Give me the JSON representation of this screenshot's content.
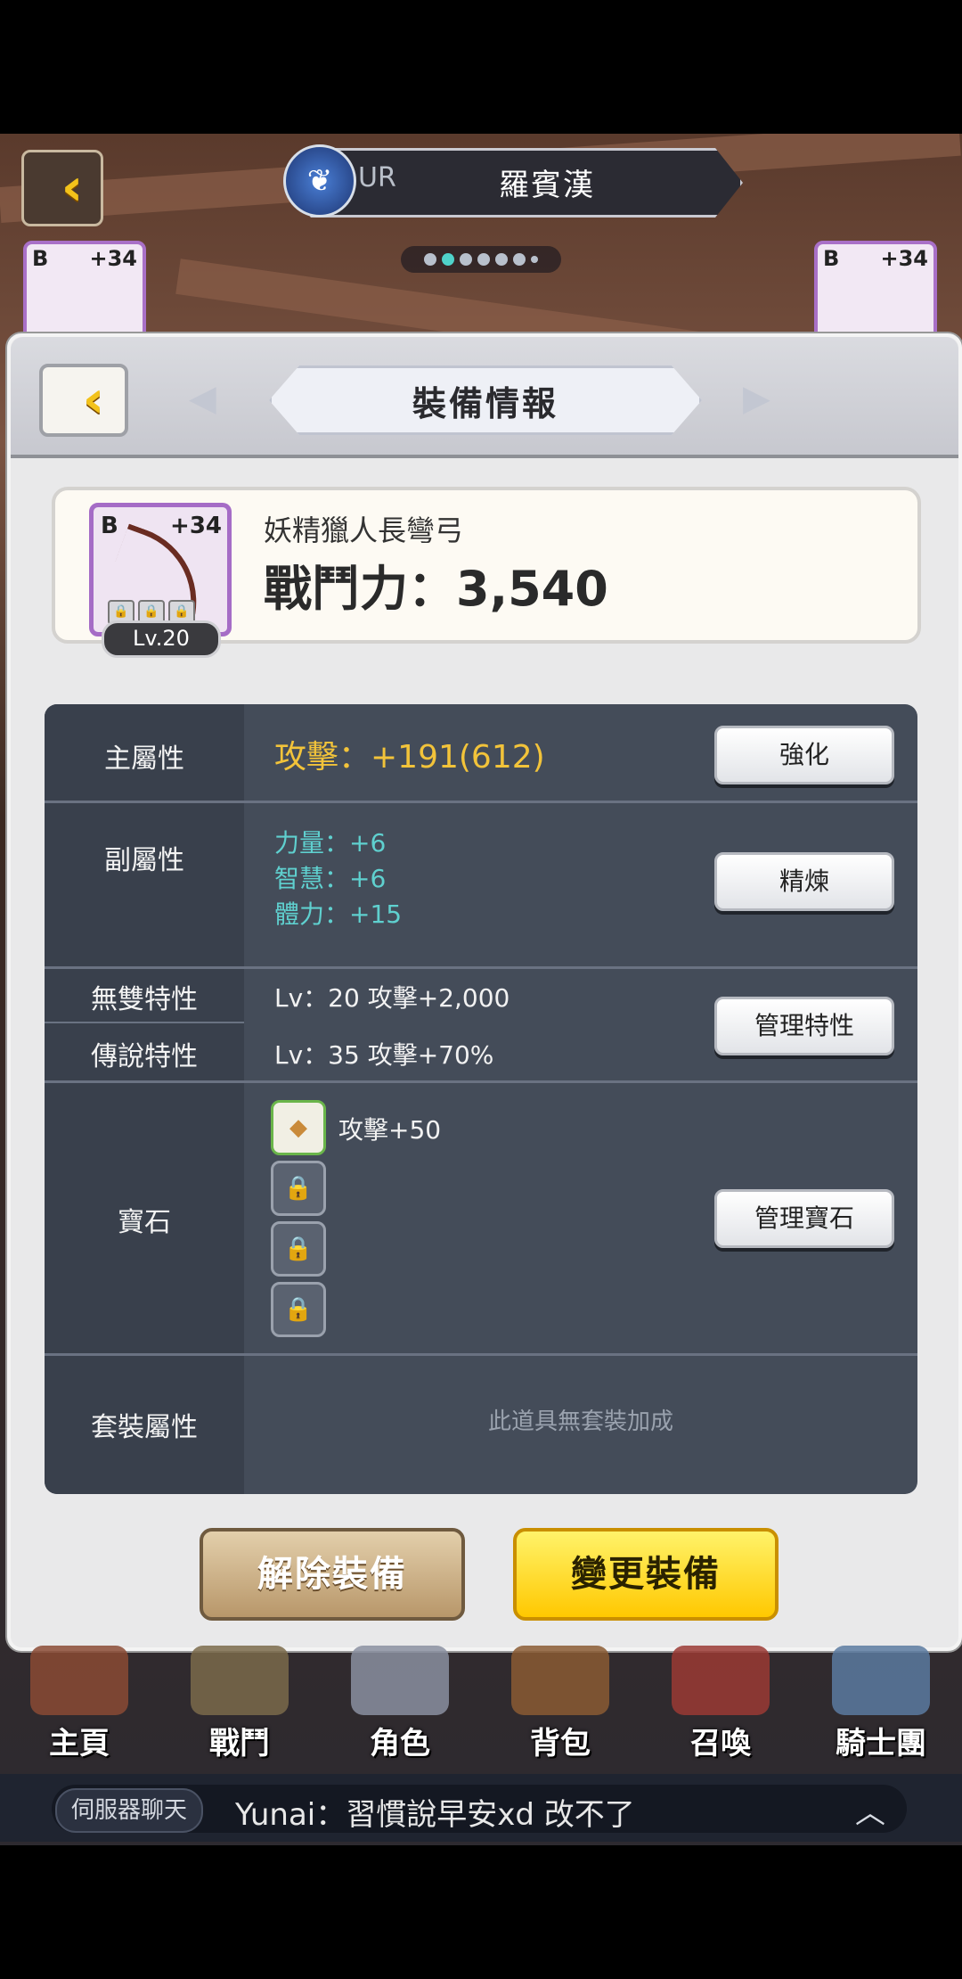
{
  "header": {
    "rank": "UR",
    "hero_name": "羅賓漢",
    "side_item_left": {
      "grade": "B",
      "plus": "+34"
    },
    "side_item_right": {
      "grade": "B",
      "plus": "+34"
    }
  },
  "panel": {
    "title": "裝備情報",
    "item": {
      "grade": "B",
      "plus": "+34",
      "level": "Lv.20",
      "name": "妖精獵人長彎弓",
      "power": "戰鬥力：3,540"
    },
    "stats": {
      "main": {
        "label": "主屬性",
        "value": "攻擊：+191(612)",
        "button": "強化"
      },
      "sub": {
        "label": "副屬性",
        "values": [
          "力量：+6",
          "智慧：+6",
          "體力：+15"
        ],
        "button": "精煉"
      },
      "unique": {
        "label": "無雙特性",
        "value": "Lv：20   攻擊+2,000"
      },
      "legend": {
        "label": "傳說特性",
        "value": "Lv：35   攻擊+70%"
      },
      "trait_button": "管理特性",
      "gem": {
        "label": "寶石",
        "slot1_text": "攻擊+50",
        "button": "管理寶石"
      },
      "set": {
        "label": "套裝屬性",
        "value": "此道具無套裝加成"
      }
    },
    "buttons": {
      "unequip": "解除裝備",
      "change": "變更裝備"
    }
  },
  "nav": [
    "主頁",
    "戰鬥",
    "角色",
    "背包",
    "召喚",
    "騎士團"
  ],
  "chat": {
    "channel": "伺服器聊天",
    "message": "Yunai：習慣說早安xd 改不了"
  }
}
